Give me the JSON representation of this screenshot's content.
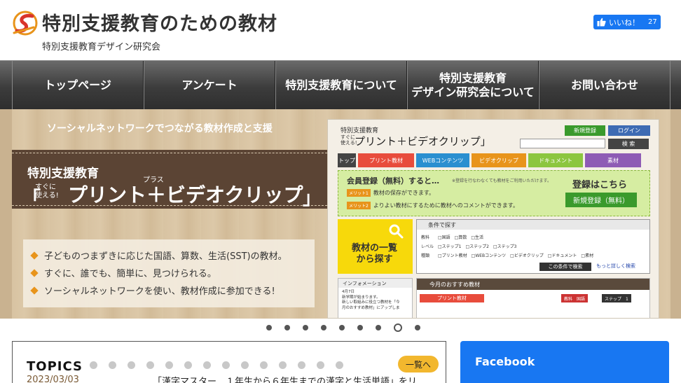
{
  "header": {
    "title": "特別支援教育のための教材",
    "subtitle": "特別支援教育デザイン研究会",
    "like_label": "いいね！",
    "like_count": "27"
  },
  "nav": {
    "items": [
      {
        "label": "トップページ"
      },
      {
        "label": "アンケート"
      },
      {
        "label": "特別支援教育について"
      },
      {
        "label": "特別支援教育\nデザイン研究会について"
      },
      {
        "label": "お問い合わせ"
      }
    ]
  },
  "banner": {
    "tagline": "ソーシャルネットワークでつながる教材作成と支援",
    "heading_small": "特別支援教育",
    "ruby": "プラス",
    "bracket_open": "「",
    "sugu": "すぐに\n使える!",
    "heading_big": "プリント＋ビデオクリップ",
    "bracket_close": "」",
    "features": [
      "子どものつまずきに応じた国語、算数、生活(SST)の教材。",
      "すぐに、誰でも、簡単に、見つけられる。",
      "ソーシャルネットワークを使い、教材作成に参加できる!"
    ],
    "mock": {
      "site_name": "特別支援教育",
      "sugu": "すぐに\n使える!",
      "title": "プリント＋ビデオクリップ」",
      "signup_btn": "新規登録",
      "login_btn": "ログイン",
      "search_btn": "検 索",
      "tabs": [
        "トップ",
        "プリント教材",
        "WEBコンテンツ",
        "ビデオクリップ",
        "ドキュメント",
        "素材"
      ],
      "reg_title": "会員登録（無料）すると…",
      "reg_note": "※登録を行なわなくても教材をご利用いただけます。",
      "merit1_badge": "メリット1",
      "merit1": "教材の保存ができます。",
      "merit2_badge": "メリット2",
      "merit2": "よりよい教材にするために教材へのコメントができます。",
      "reg_here": "登録はこちら",
      "reg_join": "新規登録（無料）",
      "find_label": "教材の一覧\nから探す",
      "filter_title": "条件で探す",
      "filter_row1": "教科　　□国語　□算数　□生活",
      "filter_row2": "レベル　□ステップ1　□ステップ2　□ステップ3",
      "filter_row3": "種類　　□プリント教材　□WEBコンテンツ　□ビデオクリップ　□ドキュメント　□素材",
      "filter_btn": "この条件で検索",
      "filter_more": "もっと詳しく検索",
      "info_title": "インフォメーション",
      "info_body": "4月7日\n新学期が始まります。\n新しい取組みに役立つ教材を「今\n月のおすすめ教材」にアップしま",
      "rec_title": "今月のおすすめ教材",
      "rec_print": "プリント教材",
      "rec_subject": "教科　国語",
      "rec_step": "ステップ　1"
    }
  },
  "slider": {
    "count": 9,
    "active_index": 7
  },
  "topics": {
    "label": "TOPICS",
    "page_dots": 14,
    "list_button": "一覧へ",
    "items": [
      {
        "date": "2023/03/03",
        "text": "「漢字マスター　１年生から６年生までの漢字と生活単語」をリ"
      }
    ]
  },
  "facebook_box": {
    "title": "Facebook"
  },
  "colors": {
    "nav_bg": "#3c3c3c",
    "banner_dark": "#5b4434",
    "accent_orange": "#e8941b",
    "list_button": "#f2b72e",
    "facebook_blue": "#1877f2",
    "topic_date": "#7a5a35"
  }
}
